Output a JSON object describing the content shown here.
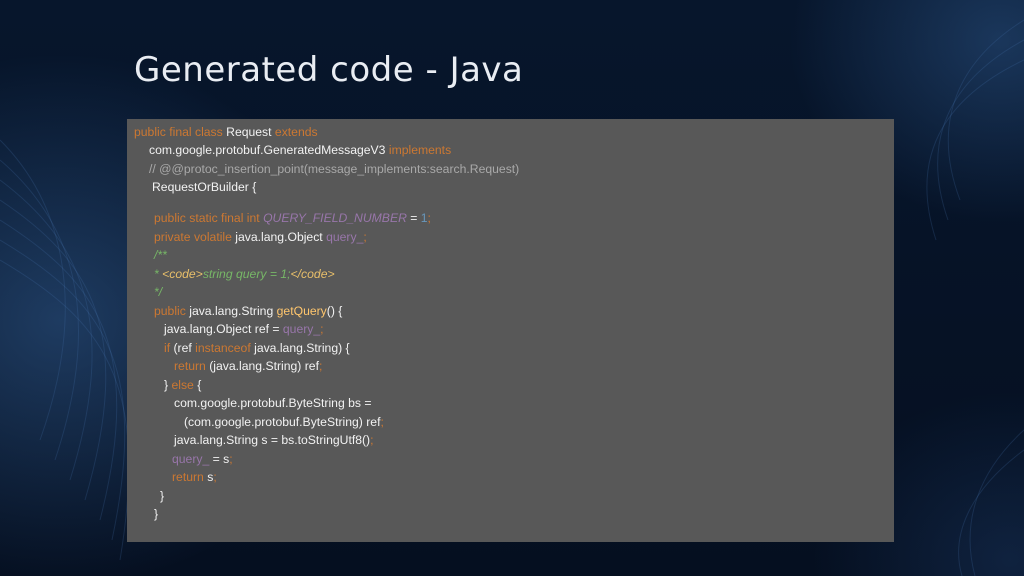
{
  "slide": {
    "title": "Generated code - Java"
  },
  "code": {
    "l1": {
      "public": "public",
      "final_class": " final class",
      "name": " Request",
      "extends": " extends"
    },
    "l2": {
      "base": "com.google.protobuf.GeneratedMessageV3",
      "implements": " implements"
    },
    "l3": {
      "comment": "// @@protoc_insertion_point(message_implements:search.Request)"
    },
    "l4": {
      "iface": "RequestOrBuilder {"
    },
    "l5": {
      "mods": "public static final int",
      "const": " QUERY_FIELD_NUMBER",
      "eq": " = ",
      "val": "1",
      "semi": ";"
    },
    "l6": {
      "mods": "private volatile",
      "type": " java.lang.Object",
      "field": " query_",
      "semi": ";"
    },
    "l7": {
      "open": "/**"
    },
    "l8": {
      "star": " * ",
      "tag_open": "<code>",
      "body": "string query = 1;",
      "tag_close": "</code>"
    },
    "l9": {
      "close": " */"
    },
    "l10": {
      "kw": "public",
      "type": " java.lang.String ",
      "method": "getQuery",
      "rest": "() {"
    },
    "l11": {
      "decl": "java.lang.Object ref = ",
      "field": "query_",
      "semi": ";"
    },
    "l12": {
      "if": "if",
      "paren": " (ref ",
      "instanceof": "instanceof",
      "rest": " java.lang.String) {"
    },
    "l13": {
      "return": "return",
      "rest": " (java.lang.String) ref",
      "semi": ";"
    },
    "l14": {
      "brace": "} ",
      "else": "else",
      "rest": " {"
    },
    "l15": {
      "decl": "com.google.protobuf.ByteString bs ="
    },
    "l16": {
      "cast": "(com.google.protobuf.ByteString) ref",
      "semi": ";"
    },
    "l17": {
      "decl": "java.lang.String s = bs.toStringUtf8()",
      "semi": ";"
    },
    "l18": {
      "field": "query_",
      "rest": " = s",
      "semi": ";"
    },
    "l19": {
      "return": "return",
      "rest": " s",
      "semi": ";"
    },
    "l20": {
      "brace": "}"
    },
    "l21": {
      "brace": "}"
    }
  }
}
